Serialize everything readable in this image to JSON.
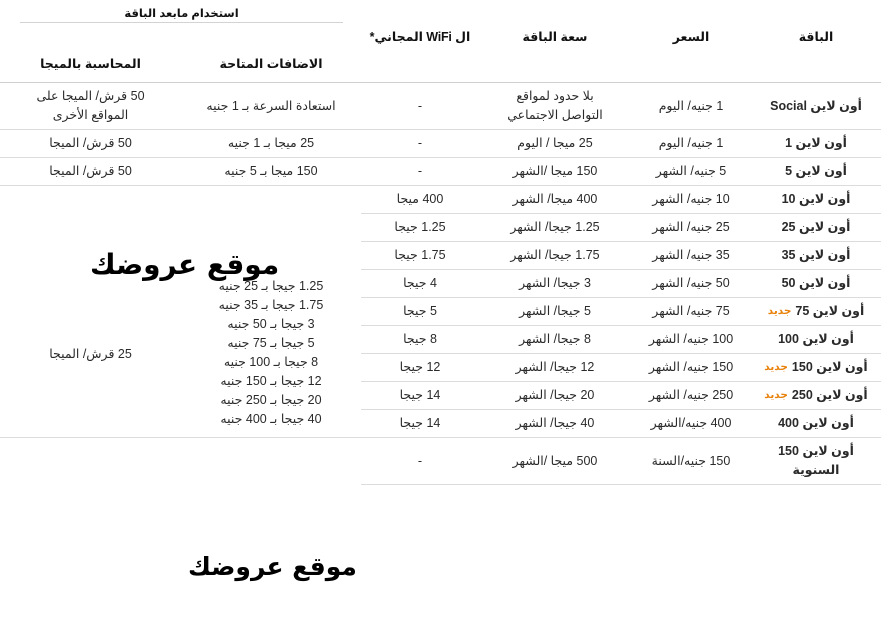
{
  "table": {
    "group_header": {
      "label": "استخدام مابعد الباقة"
    },
    "headers": {
      "package": "الباقة",
      "price": "السعر",
      "capacity": "سعة الباقة",
      "wifi": "ال WiFi المجاني*",
      "addons": "الاضافات المتاحة",
      "billing": "المحاسبة بالميجا"
    },
    "new_badge": "جديد",
    "rows": [
      {
        "name": "أون لاين Social",
        "new": false,
        "price": "1 جنيه/ اليوم",
        "capacity_line1": "بلا حدود لمواقع",
        "capacity_line2": "التواصل الاجتماعي",
        "wifi": "-",
        "addons": "استعادة السرعة بـ 1 جنيه",
        "billing_line1": "50 قرش/ الميجا على",
        "billing_line2": "المواقع الأخرى"
      },
      {
        "name": "أون لاين 1",
        "new": false,
        "price": "1 جنيه/ اليوم",
        "capacity_line1": "25 ميجا / اليوم",
        "capacity_line2": "",
        "wifi": "-",
        "addons": "25 ميجا بـ 1 جنيه",
        "billing_line1": "50 قرش/ الميجا",
        "billing_line2": ""
      },
      {
        "name": "أون لاين 5",
        "new": false,
        "price": "5 جنيه/ الشهر",
        "capacity_line1": "150 ميجا /الشهر",
        "capacity_line2": "",
        "wifi": "-",
        "addons": "150 ميجا بـ 5 جنيه",
        "billing_line1": "50 قرش/ الميجا",
        "billing_line2": ""
      },
      {
        "name": "أون لاين 10",
        "new": false,
        "price": "10 جنيه/ الشهر",
        "capacity_line1": "400 ميجا/ الشهر",
        "capacity_line2": "",
        "wifi": "400 ميجا"
      },
      {
        "name": "أون لاين 25",
        "new": false,
        "price": "25 جنيه/ الشهر",
        "capacity_line1": "1.25 جيجا/ الشهر",
        "capacity_line2": "",
        "wifi": "1.25 جيجا"
      },
      {
        "name": "أون لاين 35",
        "new": false,
        "price": "35 جنيه/ الشهر",
        "capacity_line1": "1.75 جيجا/ الشهر",
        "capacity_line2": "",
        "wifi": "1.75 جيجا"
      },
      {
        "name": "أون لاين 50",
        "new": false,
        "price": "50 جنيه/ الشهر",
        "capacity_line1": "3 جيجا/ الشهر",
        "capacity_line2": "",
        "wifi": "4 جيجا"
      },
      {
        "name": "أون لاين 75",
        "new": true,
        "price": "75 جنيه/ الشهر",
        "capacity_line1": "5 جيجا/ الشهر",
        "capacity_line2": "",
        "wifi": "5 جيجا"
      },
      {
        "name": "أون لاين 100",
        "new": false,
        "price": "100 جنيه/ الشهر",
        "capacity_line1": "8 جيجا/ الشهر",
        "capacity_line2": "",
        "wifi": "8 جيجا"
      },
      {
        "name": "أون لاين 150",
        "new": true,
        "price": "150 جنيه/ الشهر",
        "capacity_line1": "12 جيجا/ الشهر",
        "capacity_line2": "",
        "wifi": "12 جيجا"
      },
      {
        "name": "أون لاين 250",
        "new": true,
        "price": "250 جنيه/ الشهر",
        "capacity_line1": "20 جيجا/ الشهر",
        "capacity_line2": "",
        "wifi": "14 جيجا"
      },
      {
        "name": "أون لاين 400",
        "new": false,
        "price": "400 جنيه/الشهر",
        "capacity_line1": "40 جيجا/ الشهر",
        "capacity_line2": "",
        "wifi": "14 جيجا"
      },
      {
        "name": "أون لاين 150 السنوية",
        "new": false,
        "price": "150 جنيه/السنة",
        "capacity_line1": "500 ميجا /الشهر",
        "capacity_line2": "",
        "wifi": "-"
      }
    ],
    "addons_merged": {
      "lines": [
        "1.25 جيجا بـ 25 جنيه",
        "1.75 جيجا بـ 35 جنيه",
        "3 جيجا بـ 50 جنيه",
        "5 جيجا بـ 75 جنيه",
        "8 جيجا بـ 100 جنيه",
        "12 جيجا بـ 150 جنيه",
        "20 جيجا بـ 250 جنيه",
        "40 جيجا بـ 400 جنيه"
      ]
    },
    "billing_merged": {
      "text": "25 قرش/ الميجا"
    }
  },
  "watermarks": {
    "top": "موقع عروضك",
    "bottom": "موقع عروضك"
  },
  "colors": {
    "new_badge": "#e8820c",
    "text": "#222222",
    "rule": "#dcdcdc"
  }
}
